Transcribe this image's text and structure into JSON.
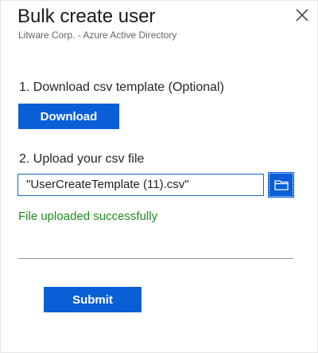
{
  "dialog": {
    "title": "Bulk create user",
    "subtitle": "Litware Corp. - Azure Active Directory",
    "close_icon": "close-icon"
  },
  "step1": {
    "label": "1. Download csv template (Optional)",
    "button_label": "Download"
  },
  "step2": {
    "label": "2. Upload your csv file",
    "file_value": "\"UserCreateTemplate (11).csv\"",
    "browse_icon": "folder-icon"
  },
  "status": {
    "message": "File uploaded successfully",
    "color": "#1f8a1f"
  },
  "actions": {
    "submit_label": "Submit"
  },
  "colors": {
    "accent": "#0a5fd7"
  }
}
